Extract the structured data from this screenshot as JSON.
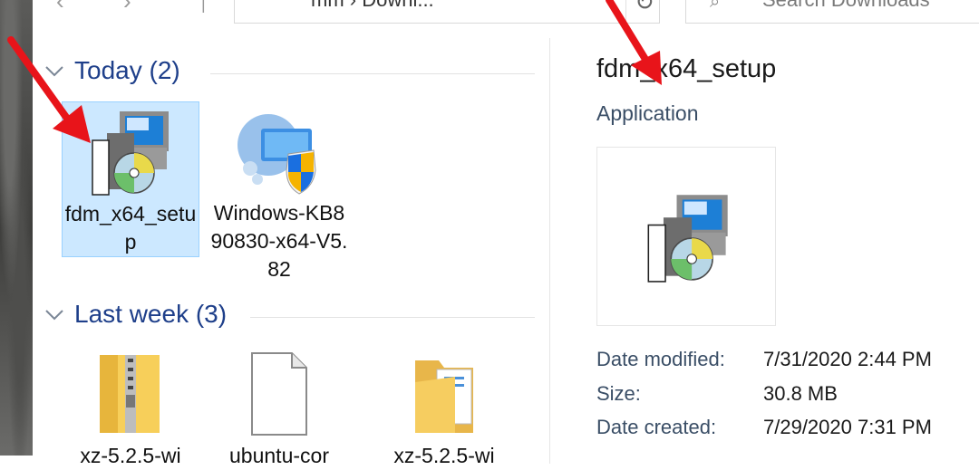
{
  "toolbar": {
    "address_text": "mm › Downl...",
    "search_placeholder": "Search Downloads"
  },
  "groups": [
    {
      "title": "Today (2)",
      "items": [
        {
          "label": "fdm_x64_setup",
          "icon": "installer-icon",
          "selected": true
        },
        {
          "label": "Windows-KB890830-x64-V5.82",
          "icon": "security-update-icon",
          "selected": false
        }
      ]
    },
    {
      "title": "Last week (3)",
      "items": [
        {
          "label": "xz-5.2.5-wi",
          "icon": "zip-folder-icon"
        },
        {
          "label": "ubuntu-cor",
          "icon": "document-icon"
        },
        {
          "label": "xz-5.2.5-wi",
          "icon": "folder-icon"
        }
      ]
    }
  ],
  "preview": {
    "name": "fdm_x64_setup",
    "type": "Application",
    "details": [
      {
        "label": "Date modified:",
        "value": "7/31/2020 2:44 PM"
      },
      {
        "label": "Size:",
        "value": "30.8 MB"
      },
      {
        "label": "Date created:",
        "value": "7/29/2020 7:31 PM"
      }
    ]
  },
  "colors": {
    "group_title": "#1e3f8a",
    "selection_bg": "#cce8ff",
    "selection_border": "#99d1ff",
    "annotation_arrow": "#e8141a"
  }
}
